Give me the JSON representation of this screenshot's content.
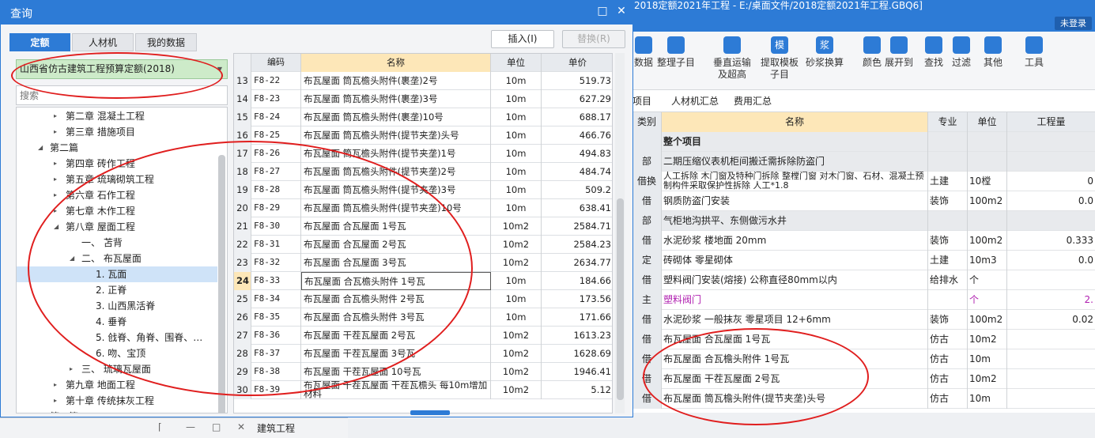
{
  "app": {
    "title": "2018定额2021年工程 - E:/桌面文件/2018定额2021年工程.GBQ6]",
    "login_label": "未登录"
  },
  "toolbar": {
    "items": [
      {
        "label": "数据",
        "icon": "data-icon"
      },
      {
        "label": "整理子目",
        "icon": "organize-icon"
      },
      {
        "label": "垂直运输\n及超高",
        "icon": "vertical-transport-icon"
      },
      {
        "label": "提取模板\n子目",
        "icon": "template-icon",
        "glyph": "模"
      },
      {
        "label": "砂浆换算",
        "icon": "mortar-icon",
        "glyph": "浆"
      },
      {
        "label": "颜色",
        "icon": "color-icon"
      },
      {
        "label": "展开到",
        "icon": "expand-icon"
      },
      {
        "label": "查找",
        "icon": "find-icon"
      },
      {
        "label": "过滤",
        "icon": "filter-icon"
      },
      {
        "label": "其他",
        "icon": "other-icon"
      },
      {
        "label": "工具",
        "icon": "tools-icon"
      }
    ]
  },
  "bg_tabs": [
    "项目",
    "人材机汇总",
    "费用汇总"
  ],
  "bg_grid": {
    "headers": [
      "类别",
      "名称",
      "专业",
      "单位",
      "工程量"
    ],
    "rows": [
      {
        "c1": "",
        "c2": "整个项目",
        "c3": "",
        "c4": "",
        "c5": "",
        "style": "gray"
      },
      {
        "c1": "部",
        "c2": "二期压缩仪表机柜间搬迁需拆除防盗门",
        "c3": "",
        "c4": "",
        "c5": "",
        "style": "gray"
      },
      {
        "c1": "借换",
        "c2": "人工拆除 木门窗及特种门拆除 整樘门窗  对木门窗、石材、混凝土预制构件采取保护性拆除 人工*1.8",
        "c3": "土建",
        "c4": "10樘",
        "c5": "0"
      },
      {
        "c1": "借",
        "c2": "钢质防盗门安装",
        "c3": "装饰",
        "c4": "100m2",
        "c5": "0.0"
      },
      {
        "c1": "部",
        "c2": "气柜地沟拱平、东侧做污水井",
        "c3": "",
        "c4": "",
        "c5": "",
        "style": "gray"
      },
      {
        "c1": "借",
        "c2": "水泥砂浆 楼地面 20mm",
        "c3": "装饰",
        "c4": "100m2",
        "c5": "0.333"
      },
      {
        "c1": "定",
        "c2": "砖砌体 零星砌体",
        "c3": "土建",
        "c4": "10m3",
        "c5": "0.0"
      },
      {
        "c1": "借",
        "c2": "塑料阀门安装(熔接) 公称直径80mm以内",
        "c3": "给排水",
        "c4": "个",
        "c5": ""
      },
      {
        "c1": "主",
        "c2": "塑料阀门",
        "c3": "",
        "c4": "个",
        "c5": "2.",
        "style": "main"
      },
      {
        "c1": "借",
        "c2": "水泥砂浆 一般抹灰 零星项目 12+6mm",
        "c3": "装饰",
        "c4": "100m2",
        "c5": "0.02"
      },
      {
        "c1": "借",
        "c2": "布瓦屋面 合瓦屋面 1号瓦",
        "c3": "仿古",
        "c4": "10m2",
        "c5": ""
      },
      {
        "c1": "借",
        "c2": "布瓦屋面 合瓦檐头附件 1号瓦",
        "c3": "仿古",
        "c4": "10m",
        "c5": ""
      },
      {
        "c1": "借",
        "c2": "布瓦屋面 干茬瓦屋面 2号瓦",
        "c3": "仿古",
        "c4": "10m2",
        "c5": ""
      },
      {
        "c1": "借",
        "c2": "布瓦屋面 筒瓦檐头附件(提节夹垄)头号",
        "c3": "仿古",
        "c4": "10m",
        "c5": ""
      }
    ]
  },
  "dialog": {
    "title": "查询",
    "tabs": [
      "定额",
      "人材机",
      "我的数据"
    ],
    "insert_label": "插入(I)",
    "replace_label": "替换(R)",
    "quota_select": "山西省仿古建筑工程预算定额(2018)",
    "search_placeholder": "搜索",
    "tree": [
      {
        "label": "第二章  混凝土工程",
        "level": 2,
        "exp": "closed"
      },
      {
        "label": "第三章  措施项目",
        "level": 2,
        "exp": "closed"
      },
      {
        "label": "第二篇",
        "level": 1,
        "exp": "open"
      },
      {
        "label": "第四章  砖作工程",
        "level": 2,
        "exp": "closed"
      },
      {
        "label": "第五章  琉璃砌筑工程",
        "level": 2,
        "exp": "closed"
      },
      {
        "label": "第六章  石作工程",
        "level": 2,
        "exp": "closed"
      },
      {
        "label": "第七章  木作工程",
        "level": 2,
        "exp": "closed"
      },
      {
        "label": "第八章  屋面工程",
        "level": 2,
        "exp": "open"
      },
      {
        "label": "一、  苫背",
        "level": 3,
        "exp": ""
      },
      {
        "label": "二、  布瓦屋面",
        "level": 3,
        "exp": "open"
      },
      {
        "label": "1.  瓦面",
        "level": 4,
        "exp": "",
        "selected": true
      },
      {
        "label": "2.  正脊",
        "level": 4,
        "exp": ""
      },
      {
        "label": "3.  山西黑活脊",
        "level": 4,
        "exp": ""
      },
      {
        "label": "4.  垂脊",
        "level": 4,
        "exp": ""
      },
      {
        "label": "5.  戗脊、角脊、围脊、…",
        "level": 4,
        "exp": ""
      },
      {
        "label": "6.  吻、宝顶",
        "level": 4,
        "exp": ""
      },
      {
        "label": "三、  琉璃瓦屋面",
        "level": 3,
        "exp": "closed"
      },
      {
        "label": "第九章  地面工程",
        "level": 2,
        "exp": "closed"
      },
      {
        "label": "第十章  传统抹灰工程",
        "level": 2,
        "exp": "closed"
      },
      {
        "label": "第三篇",
        "level": 1,
        "exp": ""
      }
    ],
    "list_headers": [
      "",
      "编码",
      "名称",
      "单位",
      "单价"
    ],
    "list": [
      {
        "n": "13",
        "code": "F8-22",
        "name": "布瓦屋面 筒瓦檐头附件(裹垄)2号",
        "unit": "10m",
        "price": "519.73"
      },
      {
        "n": "14",
        "code": "F8-23",
        "name": "布瓦屋面 筒瓦檐头附件(裹垄)3号",
        "unit": "10m",
        "price": "627.29"
      },
      {
        "n": "15",
        "code": "F8-24",
        "name": "布瓦屋面 筒瓦檐头附件(裹垄)10号",
        "unit": "10m",
        "price": "688.17"
      },
      {
        "n": "16",
        "code": "F8-25",
        "name": "布瓦屋面 筒瓦檐头附件(提节夹垄)头号",
        "unit": "10m",
        "price": "466.76"
      },
      {
        "n": "17",
        "code": "F8-26",
        "name": "布瓦屋面 筒瓦檐头附件(提节夹垄)1号",
        "unit": "10m",
        "price": "494.83"
      },
      {
        "n": "18",
        "code": "F8-27",
        "name": "布瓦屋面 筒瓦檐头附件(提节夹垄)2号",
        "unit": "10m",
        "price": "484.74"
      },
      {
        "n": "19",
        "code": "F8-28",
        "name": "布瓦屋面 筒瓦檐头附件(提节夹垄)3号",
        "unit": "10m",
        "price": "509.2"
      },
      {
        "n": "20",
        "code": "F8-29",
        "name": "布瓦屋面 筒瓦檐头附件(提节夹垄)10号",
        "unit": "10m",
        "price": "638.41"
      },
      {
        "n": "21",
        "code": "F8-30",
        "name": "布瓦屋面 合瓦屋面 1号瓦",
        "unit": "10m2",
        "price": "2584.71"
      },
      {
        "n": "22",
        "code": "F8-31",
        "name": "布瓦屋面 合瓦屋面 2号瓦",
        "unit": "10m2",
        "price": "2584.23"
      },
      {
        "n": "23",
        "code": "F8-32",
        "name": "布瓦屋面 合瓦屋面 3号瓦",
        "unit": "10m2",
        "price": "2634.77"
      },
      {
        "n": "24",
        "code": "F8-33",
        "name": "布瓦屋面 合瓦檐头附件 1号瓦",
        "unit": "10m",
        "price": "184.66",
        "current": true
      },
      {
        "n": "25",
        "code": "F8-34",
        "name": "布瓦屋面 合瓦檐头附件 2号瓦",
        "unit": "10m",
        "price": "173.56"
      },
      {
        "n": "26",
        "code": "F8-35",
        "name": "布瓦屋面 合瓦檐头附件 3号瓦",
        "unit": "10m",
        "price": "171.66"
      },
      {
        "n": "27",
        "code": "F8-36",
        "name": "布瓦屋面 干茬瓦屋面 2号瓦",
        "unit": "10m2",
        "price": "1613.23"
      },
      {
        "n": "28",
        "code": "F8-37",
        "name": "布瓦屋面 干茬瓦屋面 3号瓦",
        "unit": "10m2",
        "price": "1628.69"
      },
      {
        "n": "29",
        "code": "F8-38",
        "name": "布瓦屋面 干茬瓦屋面 10号瓦",
        "unit": "10m2",
        "price": "1946.41"
      },
      {
        "n": "30",
        "code": "F8-39",
        "name": "布瓦屋面 干茬瓦屋面 干茬瓦檐头 每10m增加材料",
        "unit": "10m2",
        "price": "5.12"
      }
    ]
  },
  "float_window": {
    "label": "建筑工程"
  },
  "colors": {
    "accent": "#2d7bd6",
    "annotation": "#e01e1e",
    "quota_bg": "#cdebc9",
    "highlight_header": "#fde7b8",
    "main_text": "#b020b0"
  }
}
